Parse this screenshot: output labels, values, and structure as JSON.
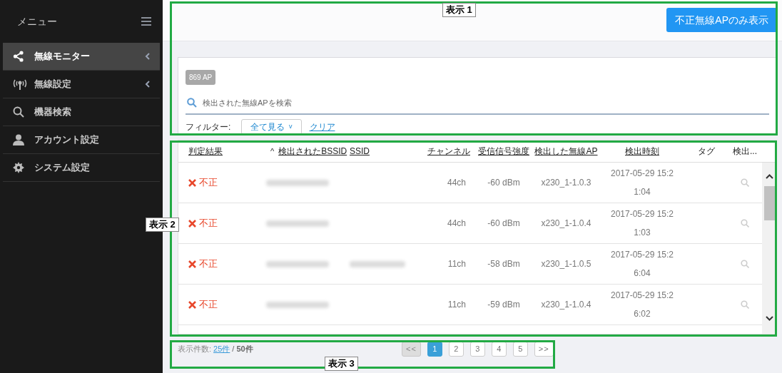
{
  "sidebar": {
    "title": "メニュー",
    "items": [
      {
        "label": "無線モニター",
        "selected": true,
        "submenu": true
      },
      {
        "label": "無線設定",
        "selected": false,
        "submenu": true
      },
      {
        "label": "機器検索",
        "selected": false,
        "submenu": false
      },
      {
        "label": "アカウント設定",
        "selected": false,
        "submenu": false
      },
      {
        "label": "システム設定",
        "selected": false,
        "submenu": false
      }
    ]
  },
  "header": {
    "button": "不正無線APのみ表示"
  },
  "search_card": {
    "badge": "869 AP",
    "search": {
      "placeholder": "検出された無線APを検索"
    },
    "filter_label": "フィルター:",
    "filter_value": "全て見る",
    "filter_caret": "v",
    "clear_link": "クリア"
  },
  "table": {
    "columns": [
      {
        "label": "判定結果",
        "link": true
      },
      {
        "label": "検出されたBSSID",
        "link": true,
        "sort_mark": "^"
      },
      {
        "label": "SSID",
        "link": true
      },
      {
        "label": "チャンネル",
        "link": true
      },
      {
        "label": "受信信号強度",
        "link": true
      },
      {
        "label": "検出した無線AP",
        "link": true
      },
      {
        "label": "検出時刻",
        "link": true
      },
      {
        "label": "タグ",
        "link": false
      },
      {
        "label": "検出...",
        "link": false
      }
    ],
    "rows": [
      {
        "verdict": "不正",
        "bssid_redacted": true,
        "ssid_redacted": false,
        "channel": "44ch",
        "signal": "-60 dBm",
        "ap": "x230_1-1.0.3",
        "time": "2017-05-29 15:21:04"
      },
      {
        "verdict": "不正",
        "bssid_redacted": true,
        "ssid_redacted": false,
        "channel": "44ch",
        "signal": "-60 dBm",
        "ap": "x230_1-1.0.4",
        "time": "2017-05-29 15:21:03"
      },
      {
        "verdict": "不正",
        "bssid_redacted": true,
        "ssid_redacted": true,
        "channel": "11ch",
        "signal": "-58 dBm",
        "ap": "x230_1-1.0.5",
        "time": "2017-05-29 15:26:04"
      },
      {
        "verdict": "不正",
        "bssid_redacted": true,
        "ssid_redacted": false,
        "channel": "11ch",
        "signal": "-59 dBm",
        "ap": "x230_1-1.0.4",
        "time": "2017-05-29 15:26:02"
      }
    ]
  },
  "footer": {
    "count_label": "表示件数:",
    "per_page": "25件",
    "separator": "/",
    "total": "50件",
    "pagination": [
      {
        "label": "<<",
        "kind": "nav",
        "disabled": true,
        "selected": false
      },
      {
        "label": "1",
        "kind": "page",
        "disabled": false,
        "selected": true
      },
      {
        "label": "2",
        "kind": "page",
        "disabled": false,
        "selected": false
      },
      {
        "label": "3",
        "kind": "page",
        "disabled": false,
        "selected": false
      },
      {
        "label": "4",
        "kind": "page",
        "disabled": false,
        "selected": false
      },
      {
        "label": "5",
        "kind": "page",
        "disabled": false,
        "selected": false
      },
      {
        "label": ">>",
        "kind": "nav",
        "disabled": false,
        "selected": false
      }
    ]
  },
  "annotations": [
    "表示 1",
    "表示 2",
    "表示 3"
  ]
}
